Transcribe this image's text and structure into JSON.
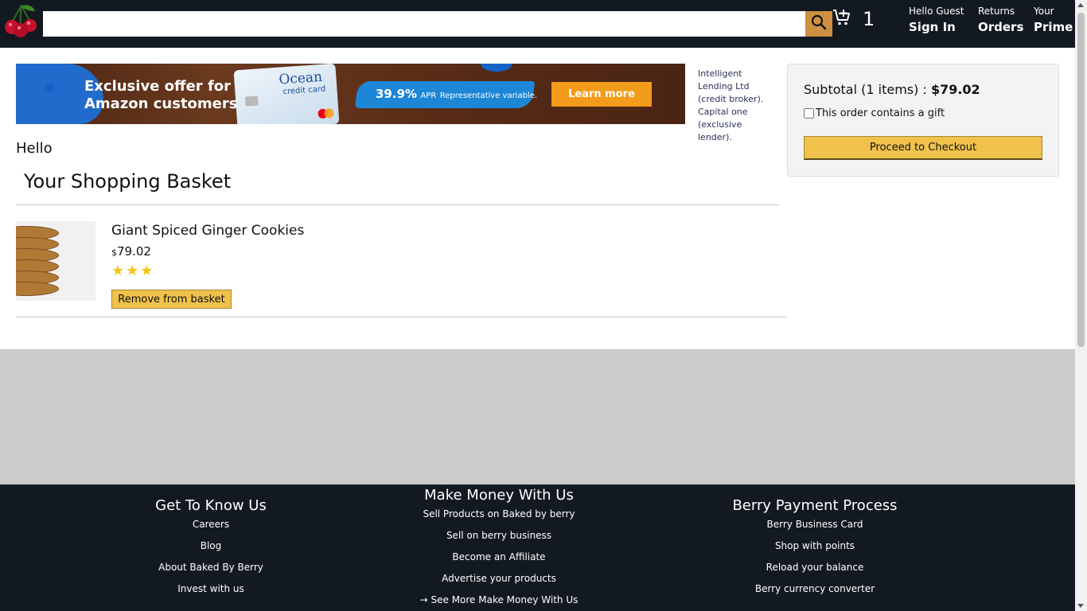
{
  "header": {
    "search": {
      "value": "",
      "placeholder": ""
    },
    "cart_count": "1",
    "nav": [
      {
        "line1": "Hello Guest",
        "line2": "Sign In"
      },
      {
        "line1": "Returns",
        "line2": "Orders"
      },
      {
        "line1": "Your",
        "line2": "Prime"
      }
    ]
  },
  "ad": {
    "headline_line1": "Exclusive offer for",
    "headline_line2": "Amazon customers",
    "card_brand": "Ocean",
    "card_sub": "credit card",
    "apr_value": "39.9%",
    "apr_label": "APR",
    "apr_note": "Representative variable.",
    "button": "Learn more",
    "side_text": "Intelligent Lending Ltd (credit broker). Capital one (exclusive lender)."
  },
  "main": {
    "greeting": "Hello",
    "basket_title": "Your Shopping Basket",
    "items": [
      {
        "title": "Giant Spiced Ginger Cookies",
        "currency": "$",
        "price": "79.02",
        "rating": 3,
        "remove_label": "Remove from basket"
      }
    ]
  },
  "subtotal": {
    "label": "Subtotal (1 items) :",
    "amount": "$79.02",
    "gift_label": "This order contains a gift",
    "gift_checked": false,
    "checkout_label": "Proceed to Checkout"
  },
  "footer": {
    "columns": [
      {
        "title": "Get To Know Us",
        "links": [
          "Careers",
          "Blog",
          "About Baked By Berry",
          "Invest with us"
        ]
      },
      {
        "title": "Make Money With Us",
        "links": [
          "Sell Products on Baked by berry",
          "Sell on berry business",
          "Become an Affiliate",
          "Advertise your products",
          "→ See More Make Money With Us"
        ]
      },
      {
        "title": "Berry Payment Process",
        "links": [
          "Berry Business Card",
          "Shop with points",
          "Reload your balance",
          "Berry currency converter"
        ]
      }
    ]
  },
  "colors": {
    "header_bg": "#131921",
    "search_button": "#cd9042",
    "button_yellow": "#f0c14b",
    "gray_band": "#cbcbcb",
    "star": "#f4c316"
  },
  "icons": [
    "cherry-logo-icon",
    "search-icon",
    "cart-icon",
    "star-icon"
  ]
}
